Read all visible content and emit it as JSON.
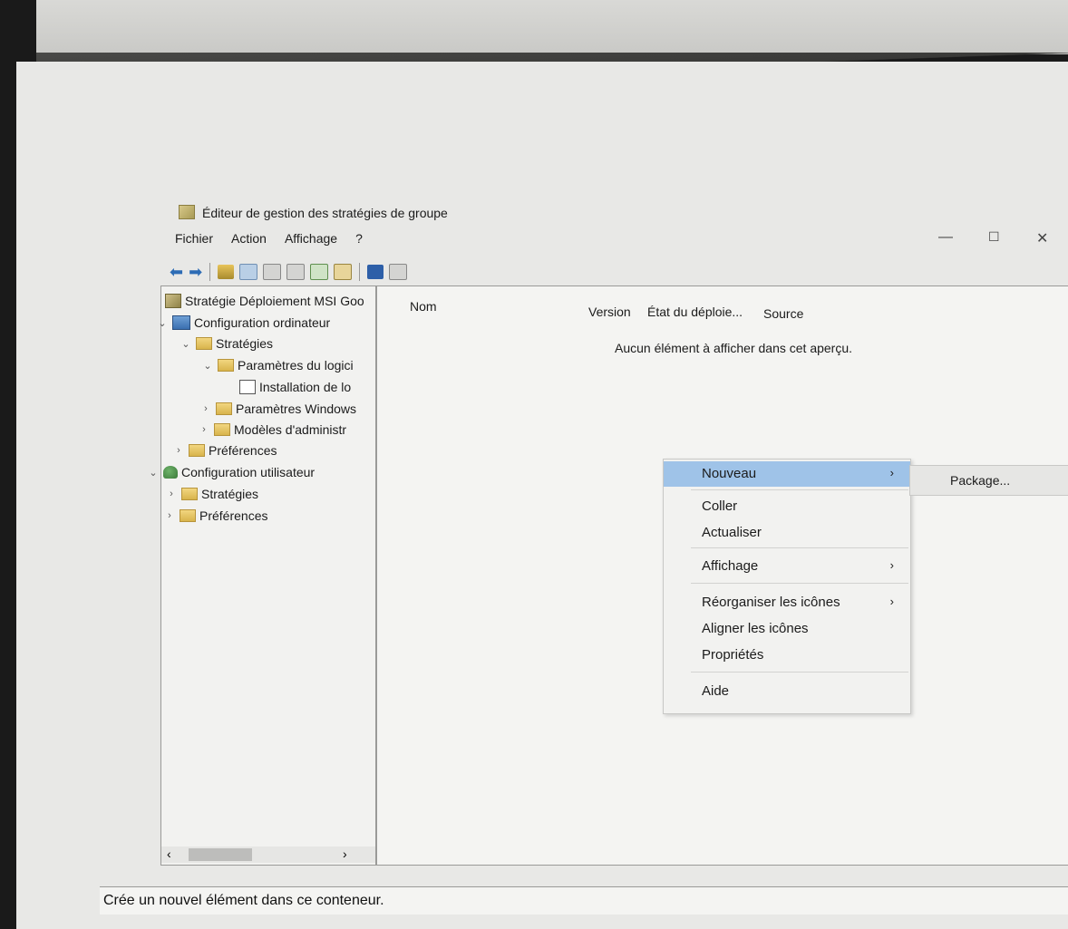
{
  "window": {
    "title": "Éditeur de gestion des stratégies de groupe",
    "controls": {
      "minimize": "—",
      "maximize": "☐",
      "close": "✕"
    }
  },
  "menu": {
    "items": [
      "Fichier",
      "Action",
      "Affichage",
      "?"
    ]
  },
  "tree": {
    "items": [
      {
        "label": "Stratégie Déploiement MSI Goo",
        "icon": "gpo-icon",
        "chevron": ""
      },
      {
        "label": "Configuration ordinateur",
        "icon": "computer-icon",
        "chevron": "⌄"
      },
      {
        "label": "Stratégies",
        "icon": "folder-icon",
        "chevron": "⌄"
      },
      {
        "label": "Paramètres du logici",
        "icon": "folder-icon",
        "chevron": "⌄"
      },
      {
        "label": "Installation de lo",
        "icon": "install-icon",
        "chevron": ""
      },
      {
        "label": "Paramètres Windows",
        "icon": "folder-icon",
        "chevron": "›"
      },
      {
        "label": "Modèles d'administr",
        "icon": "folder-icon",
        "chevron": "›"
      },
      {
        "label": "Préférences",
        "icon": "folder-icon",
        "chevron": "›"
      },
      {
        "label": "Configuration utilisateur",
        "icon": "user-icon",
        "chevron": "⌄"
      },
      {
        "label": "Stratégies",
        "icon": "folder-icon",
        "chevron": "›"
      },
      {
        "label": "Préférences",
        "icon": "folder-icon",
        "chevron": "›"
      }
    ],
    "scroll": {
      "left": "‹",
      "right": "›"
    }
  },
  "list": {
    "columns": [
      "Nom",
      "Version",
      "État du déploie...",
      "Source"
    ],
    "empty_text": "Aucun élément à afficher dans cet aperçu."
  },
  "context_menu": {
    "items": [
      {
        "label": "Nouveau",
        "arrow": "›"
      },
      {
        "label": "Coller",
        "arrow": ""
      },
      {
        "label": "Actualiser",
        "arrow": ""
      },
      {
        "label": "Affichage",
        "arrow": "›"
      },
      {
        "label": "Réorganiser les icônes",
        "arrow": "›"
      },
      {
        "label": "Aligner les icônes",
        "arrow": ""
      },
      {
        "label": "Propriétés",
        "arrow": ""
      },
      {
        "label": "Aide",
        "arrow": ""
      }
    ],
    "submenu": {
      "label": "Package..."
    }
  },
  "status": {
    "text": "Crée un nouvel élément dans ce conteneur."
  }
}
